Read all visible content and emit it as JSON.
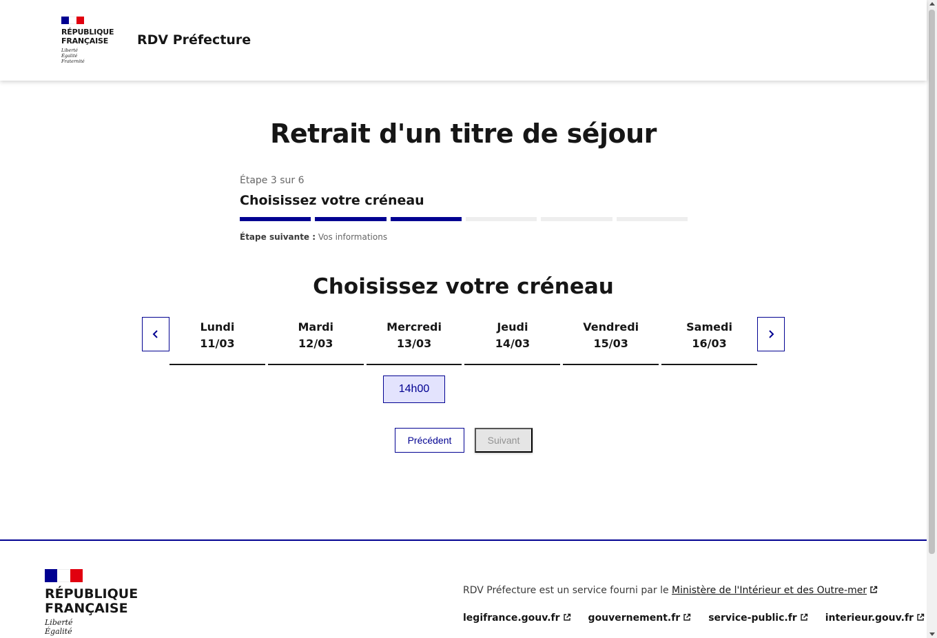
{
  "header": {
    "logo_name_line1": "RÉPUBLIQUE",
    "logo_name_line2": "FRANÇAISE",
    "logo_motto_1": "Liberté",
    "logo_motto_2": "Égalité",
    "logo_motto_3": "Fraternité",
    "service_title": "RDV Préfecture"
  },
  "main": {
    "page_title": "Retrait d'un titre de séjour",
    "stepper": {
      "state": "Étape 3 sur 6",
      "title": "Choisissez votre créneau",
      "current_step": 3,
      "total_steps": 6,
      "next_label": "Étape suivante :",
      "next_value": "Vos informations"
    },
    "section_title": "Choisissez votre créneau",
    "days": [
      {
        "name": "Lundi",
        "date": "11/03"
      },
      {
        "name": "Mardi",
        "date": "12/03"
      },
      {
        "name": "Mercredi",
        "date": "13/03"
      },
      {
        "name": "Jeudi",
        "date": "14/03"
      },
      {
        "name": "Vendredi",
        "date": "15/03"
      },
      {
        "name": "Samedi",
        "date": "16/03"
      }
    ],
    "slot": {
      "time": "14h00",
      "day_index": 2
    },
    "buttons": {
      "previous": "Précédent",
      "next": "Suivant"
    }
  },
  "footer": {
    "logo_name_line1": "RÉPUBLIQUE",
    "logo_name_line2": "FRANÇAISE",
    "logo_motto_1": "Liberté",
    "logo_motto_2": "Égalité",
    "description_prefix": "RDV Préfecture est un service fourni par le",
    "description_link": "Ministère de l'Intérieur et des Outre-mer",
    "links": [
      "legifrance.gouv.fr",
      "gouvernement.fr",
      "service-public.fr",
      "interieur.gouv.fr"
    ]
  },
  "colors": {
    "primary": "#000091",
    "marianne_red": "#e1000f",
    "slot_bg": "#e3e3fd",
    "disabled_bg": "#e5e5e5"
  },
  "icons": {
    "prev": "chevron-left-icon",
    "next": "chevron-right-icon",
    "external": "external-link-icon"
  }
}
